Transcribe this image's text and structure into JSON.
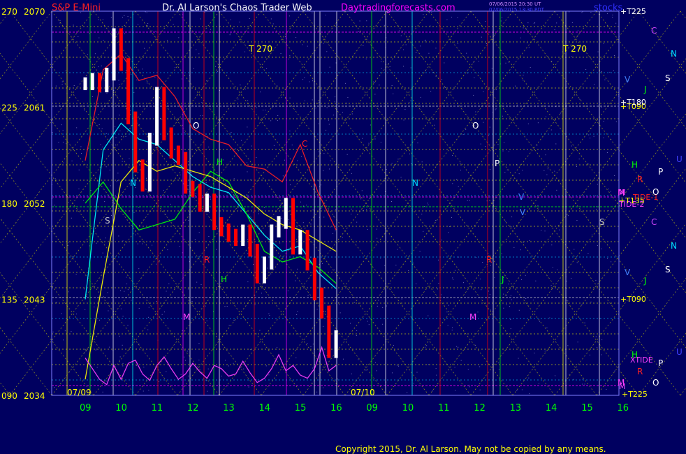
{
  "header": {
    "instrument": "S&P E-Mini",
    "title": "Dr. Al Larson's Chaos Trader Web",
    "site": "Daytradingforecasts.com",
    "stamp_line1": "07/06/2015 20:30 UT",
    "stamp_line2": "07/06/2015 13:30 PDT",
    "tag": "stocks"
  },
  "copyright": "Copyright 2015, Dr. Al Larson. May not be copied by any means.",
  "colors": {
    "background": "#000060",
    "price_up": "#ffffff",
    "price_down": "#ff0000",
    "grid_yellow": "#ffff00",
    "accent_magenta": "#ff00ff",
    "accent_green": "#00ff00",
    "accent_cyan": "#00ffff"
  },
  "chart_data": {
    "type": "line",
    "y_axis_left_price": {
      "ticks": [
        "2070",
        "2061",
        "2052",
        "2043",
        "2034"
      ],
      "ylim": [
        2034,
        2070
      ]
    },
    "y_axis_left_angle": {
      "ticks": [
        "270",
        "225",
        "180",
        "135",
        "090"
      ]
    },
    "x_axis": {
      "tick_labels": [
        "09",
        "10",
        "11",
        "12",
        "13",
        "14",
        "15",
        "16",
        "09",
        "10",
        "11",
        "12",
        "13",
        "14",
        "15",
        "16"
      ],
      "date_labels": [
        "07/09",
        "07/10"
      ]
    },
    "right_labels": [
      "+T225",
      "+T090",
      "+T180",
      "TIDE-1",
      "TIDE-2",
      "+T135",
      "+T090",
      "XTIDE",
      "+T225",
      "M",
      "M"
    ],
    "planet_labels_right": [
      "C",
      "N",
      "S",
      "V",
      "J",
      "U",
      "H",
      "P",
      "R",
      "O",
      "M",
      "C",
      "N",
      "S",
      "V",
      "J",
      "U",
      "H",
      "P",
      "R",
      "O",
      "M"
    ],
    "chart_letters": [
      "T 270",
      "T 270",
      "O",
      "O",
      "P",
      "N",
      "N",
      "C",
      "S",
      "S",
      "H",
      "H",
      "R",
      "R",
      "M",
      "M",
      "J",
      "V",
      "V"
    ],
    "series": [
      {
        "name": "price",
        "x": [
          9.0,
          9.2,
          9.4,
          9.6,
          9.8,
          10.0,
          10.2,
          10.4,
          10.6,
          10.8,
          11.0,
          11.2,
          11.4,
          11.6,
          11.8,
          12.0,
          12.2,
          12.4,
          12.6,
          12.8,
          13.0,
          13.2,
          13.4,
          13.6,
          13.8,
          14.0,
          14.2,
          14.4,
          14.6,
          14.8,
          15.0,
          15.2,
          15.4,
          15.6,
          15.8,
          16.0
        ],
        "values": [
          2063.2,
          2063.6,
          2063.0,
          2064.1,
          2067.8,
          2065.0,
          2060.0,
          2055.5,
          2053.7,
          2058.0,
          2062.3,
          2058.5,
          2056.8,
          2056.2,
          2053.5,
          2053.2,
          2051.8,
          2052.3,
          2050.1,
          2049.5,
          2049.0,
          2048.6,
          2049.4,
          2047.6,
          2045.1,
          2046.4,
          2049.4,
          2050.2,
          2051.9,
          2047.8,
          2048.9,
          2046.3,
          2043.5,
          2041.8,
          2038.1,
          2039.5
        ]
      },
      {
        "name": "",
        "x": [
          9.0,
          9.5,
          10.0,
          10.5,
          11.0,
          11.5,
          12.0,
          12.5,
          13.0,
          13.5,
          14.0,
          14.5,
          15.0,
          15.5,
          16.0
        ],
        "values": [
          2056.0,
          2064.5,
          2066.0,
          2063.5,
          2064.0,
          2062.0,
          2059.0,
          2058.0,
          2057.5,
          2055.5,
          2055.2,
          2054.0,
          2057.5,
          2053.0,
          2049.5
        ]
      },
      {
        "name": "",
        "x": [
          9.0,
          9.5,
          10.0,
          10.5,
          11.0,
          11.5,
          12.0,
          12.5,
          13.0,
          13.5,
          14.0,
          14.5,
          15.0,
          15.5,
          16.0
        ],
        "values": [
          2043.0,
          2057.0,
          2059.5,
          2058.0,
          2057.5,
          2056.0,
          2054.5,
          2053.5,
          2053.0,
          2051.0,
          2049.0,
          2047.5,
          2048.0,
          2045.5,
          2044.0
        ]
      },
      {
        "name": "",
        "x": [
          9.0,
          9.5,
          10.0,
          10.5,
          11.0,
          11.5,
          12.0,
          12.5,
          13.0,
          13.5,
          14.0,
          14.5,
          15.0,
          15.5,
          16.0
        ],
        "values": [
          2052.0,
          2054.0,
          2051.5,
          2049.5,
          2050.0,
          2050.5,
          2053.0,
          2055.0,
          2054.0,
          2051.0,
          2047.5,
          2046.5,
          2047.0,
          2046.0,
          2044.5
        ]
      },
      {
        "name": "",
        "x": [
          9.0,
          9.5,
          10.0,
          10.5,
          11.0,
          11.5,
          12.0,
          12.5,
          13.0,
          13.5,
          14.0,
          14.5,
          15.0,
          15.5,
          16.0
        ],
        "values": [
          2035.5,
          2045.0,
          2054.0,
          2056.0,
          2055.0,
          2055.5,
          2055.0,
          2054.5,
          2053.5,
          2052.5,
          2051.0,
          2050.0,
          2049.5,
          2048.5,
          2047.5
        ]
      },
      {
        "name": "XTIDE",
        "x": [
          9.0,
          9.2,
          9.4,
          9.6,
          9.8,
          10.0,
          10.2,
          10.4,
          10.6,
          10.8,
          11.0,
          11.2,
          11.4,
          11.6,
          11.8,
          12.0,
          12.2,
          12.4,
          12.6,
          12.8,
          13.0,
          13.2,
          13.4,
          13.6,
          13.8,
          14.0,
          14.2,
          14.4,
          14.6,
          14.8,
          15.0,
          15.2,
          15.4,
          15.6,
          15.8,
          16.0
        ],
        "values": [
          2037.5,
          2036.5,
          2035.5,
          2035.0,
          2036.8,
          2035.5,
          2037.0,
          2037.3,
          2036.0,
          2035.4,
          2036.8,
          2037.6,
          2036.5,
          2035.5,
          2036.0,
          2037.0,
          2036.2,
          2035.6,
          2036.8,
          2036.5,
          2035.8,
          2036.0,
          2037.2,
          2036.1,
          2035.2,
          2035.6,
          2036.5,
          2037.8,
          2036.3,
          2036.8,
          2035.9,
          2035.6,
          2036.5,
          2038.5,
          2036.3,
          2036.8
        ]
      }
    ]
  }
}
